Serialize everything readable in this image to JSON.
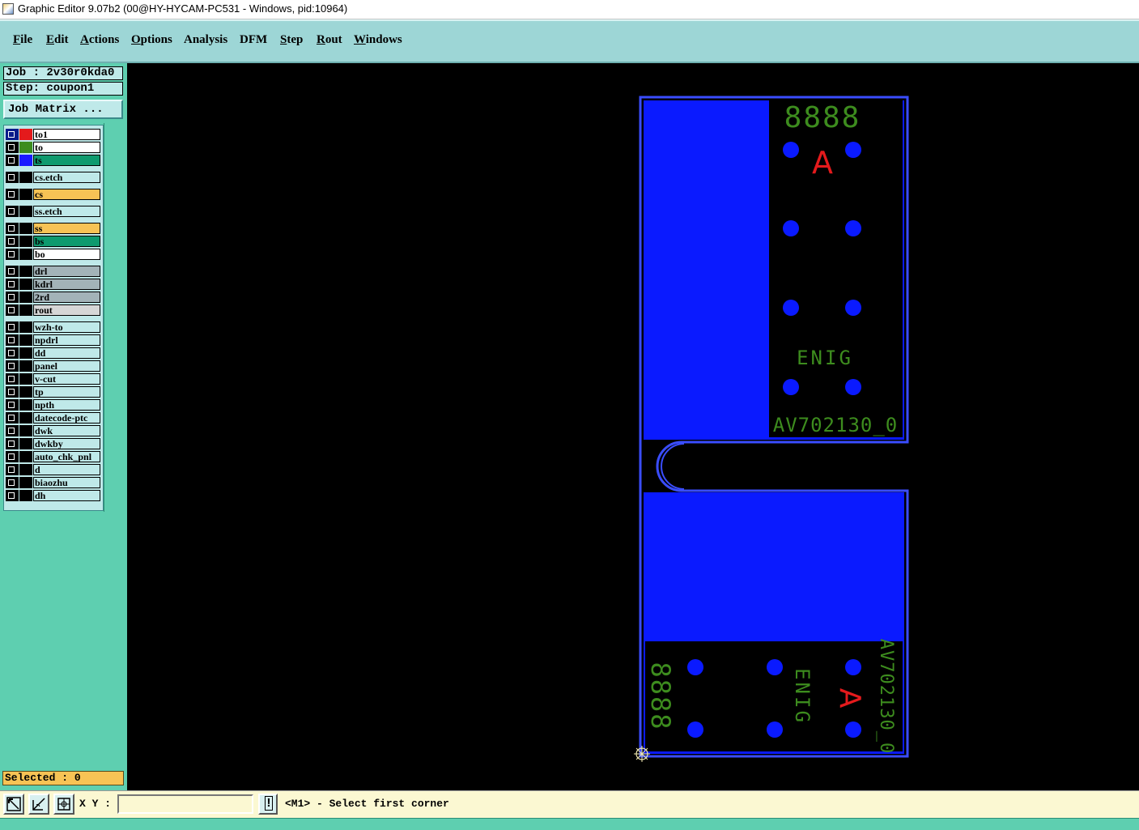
{
  "window": {
    "title": "Graphic Editor 9.07b2 (00@HY-HYCAM-PC531 - Windows, pid:10964)"
  },
  "menu": [
    {
      "label": "File",
      "ul": "F",
      "rest": "ile"
    },
    {
      "label": "Edit",
      "ul": "E",
      "rest": "dit"
    },
    {
      "label": "Actions",
      "ul": "A",
      "rest": "ctions"
    },
    {
      "label": "Options",
      "ul": "O",
      "rest": "ptions"
    },
    {
      "label": "Analysis",
      "ul": "",
      "rest": "Analysis"
    },
    {
      "label": "DFM",
      "ul": "",
      "rest": "DFM"
    },
    {
      "label": "Step",
      "ul": "S",
      "rest": "tep"
    },
    {
      "label": "Rout",
      "ul": "R",
      "rest": "out"
    },
    {
      "label": "Windows",
      "ul": "W",
      "rest": "indows"
    }
  ],
  "panel": {
    "job": "Job : 2v30r0kda0",
    "step": "Step: coupon1",
    "job_matrix_label": "Job Matrix ...",
    "selected": "Selected : 0"
  },
  "layers": [
    {
      "name": "to1",
      "bg": "#ffffff",
      "swatch": "#e41a1c",
      "active": true
    },
    {
      "name": "to",
      "bg": "#ffffff",
      "swatch": "#3d8c1e"
    },
    {
      "name": "ts",
      "bg": "#0e9a6e",
      "swatch": "#1a1aff"
    },
    {
      "name": "cs.etch",
      "bg": "#bfe9e9",
      "swatch": "#000000"
    },
    {
      "name": "cs",
      "bg": "#f7c355",
      "swatch": "#000000"
    },
    {
      "name": "ss.etch",
      "bg": "#bfe9e9",
      "swatch": "#000000"
    },
    {
      "name": "ss",
      "bg": "#f7c355",
      "swatch": "#000000"
    },
    {
      "name": "bs",
      "bg": "#0e9a6e",
      "swatch": "#000000"
    },
    {
      "name": "bo",
      "bg": "#ffffff",
      "swatch": "#000000"
    },
    {
      "name": "drl",
      "bg": "#a3b3b8",
      "swatch": "#000000"
    },
    {
      "name": "kdrl",
      "bg": "#a3b3b8",
      "swatch": "#000000"
    },
    {
      "name": "2rd",
      "bg": "#a3b3b8",
      "swatch": "#000000"
    },
    {
      "name": "rout",
      "bg": "#d6d6d6",
      "swatch": "#000000"
    },
    {
      "name": "wzh-to",
      "bg": "#bfe9e9",
      "swatch": "#000000"
    },
    {
      "name": "npdrl",
      "bg": "#bfe9e9",
      "swatch": "#000000"
    },
    {
      "name": "dd",
      "bg": "#bfe9e9",
      "swatch": "#000000"
    },
    {
      "name": "panel",
      "bg": "#bfe9e9",
      "swatch": "#000000"
    },
    {
      "name": "v-cut",
      "bg": "#bfe9e9",
      "swatch": "#000000"
    },
    {
      "name": "tp",
      "bg": "#bfe9e9",
      "swatch": "#000000"
    },
    {
      "name": "npth",
      "bg": "#bfe9e9",
      "swatch": "#000000"
    },
    {
      "name": "datecode-ptc",
      "bg": "#bfe9e9",
      "swatch": "#000000"
    },
    {
      "name": "dwk",
      "bg": "#bfe9e9",
      "swatch": "#000000"
    },
    {
      "name": "dwkby",
      "bg": "#bfe9e9",
      "swatch": "#000000"
    },
    {
      "name": "auto_chk_pnl",
      "bg": "#bfe9e9",
      "swatch": "#000000"
    },
    {
      "name": "d",
      "bg": "#bfe9e9",
      "swatch": "#000000"
    },
    {
      "name": "biaozhu",
      "bg": "#bfe9e9",
      "swatch": "#000000"
    },
    {
      "name": "dh",
      "bg": "#bfe9e9",
      "swatch": "#000000"
    }
  ],
  "canvas": {
    "top_code": "8888",
    "top_rev": "A",
    "top_finish": "ENIG",
    "top_part": "AV702130_0",
    "bottom_code": "8888",
    "bottom_rev": "A",
    "bottom_finish": "ENIG",
    "bottom_part": "AV702130_0",
    "colors": {
      "copper": "#0a1aff",
      "outline": "#3a4dff",
      "silk_text": "#3d8c1e",
      "rev_text": "#e41a1c"
    }
  },
  "bottom": {
    "xy_label": "X Y :",
    "xy_value": "",
    "info_icon": "!",
    "status": "<M1> - Select first corner"
  }
}
